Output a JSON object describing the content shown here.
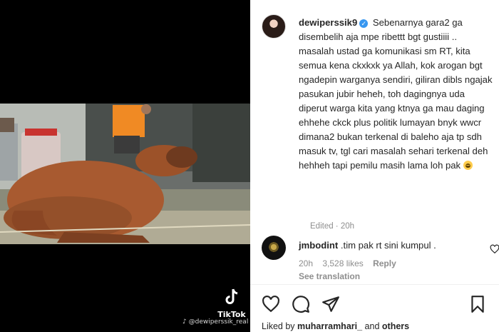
{
  "video": {
    "tiktok_label": "TikTok",
    "tiktok_user": "@dewiperssik_real"
  },
  "post": {
    "username": "dewiperssik9",
    "caption": "Sebenarnya gara2 ga disembelih aja mpe ribettt bgt gustiiii .. masalah ustad ga komunikasi sm RT, kita semua kena ckxkxk ya Allah, kok arogan bgt ngadepin warganya sendiri, giliran dibls ngajak pasukan jubir heheh, toh dagingnya uda diperut warga kita yang ktnya ga mau daging ehhehe ckck plus politik lumayan bnyk wwcr dimana2 bukan terkenal di baleho aja tp sdh masuk tv, tgl cari masalah sehari terkenal deh hehheh tapi pemilu masih lama loh pak",
    "edited": "Edited",
    "time": "20h"
  },
  "comment": {
    "username": "jmbodint",
    "text": ".tim pak rt sini kumpul .",
    "time": "20h",
    "likes": "3,528 likes",
    "reply": "Reply",
    "see_translation": "See translation"
  },
  "liked_by": {
    "prefix": "Liked by",
    "user": "muharramhari_",
    "and": "and",
    "others": "others"
  },
  "icons": {
    "like": "heart-icon",
    "comment": "comment-icon",
    "share": "share-icon",
    "save": "bookmark-icon"
  },
  "colors": {
    "verified": "#3897f0",
    "meta_text": "#8e8e8e"
  }
}
